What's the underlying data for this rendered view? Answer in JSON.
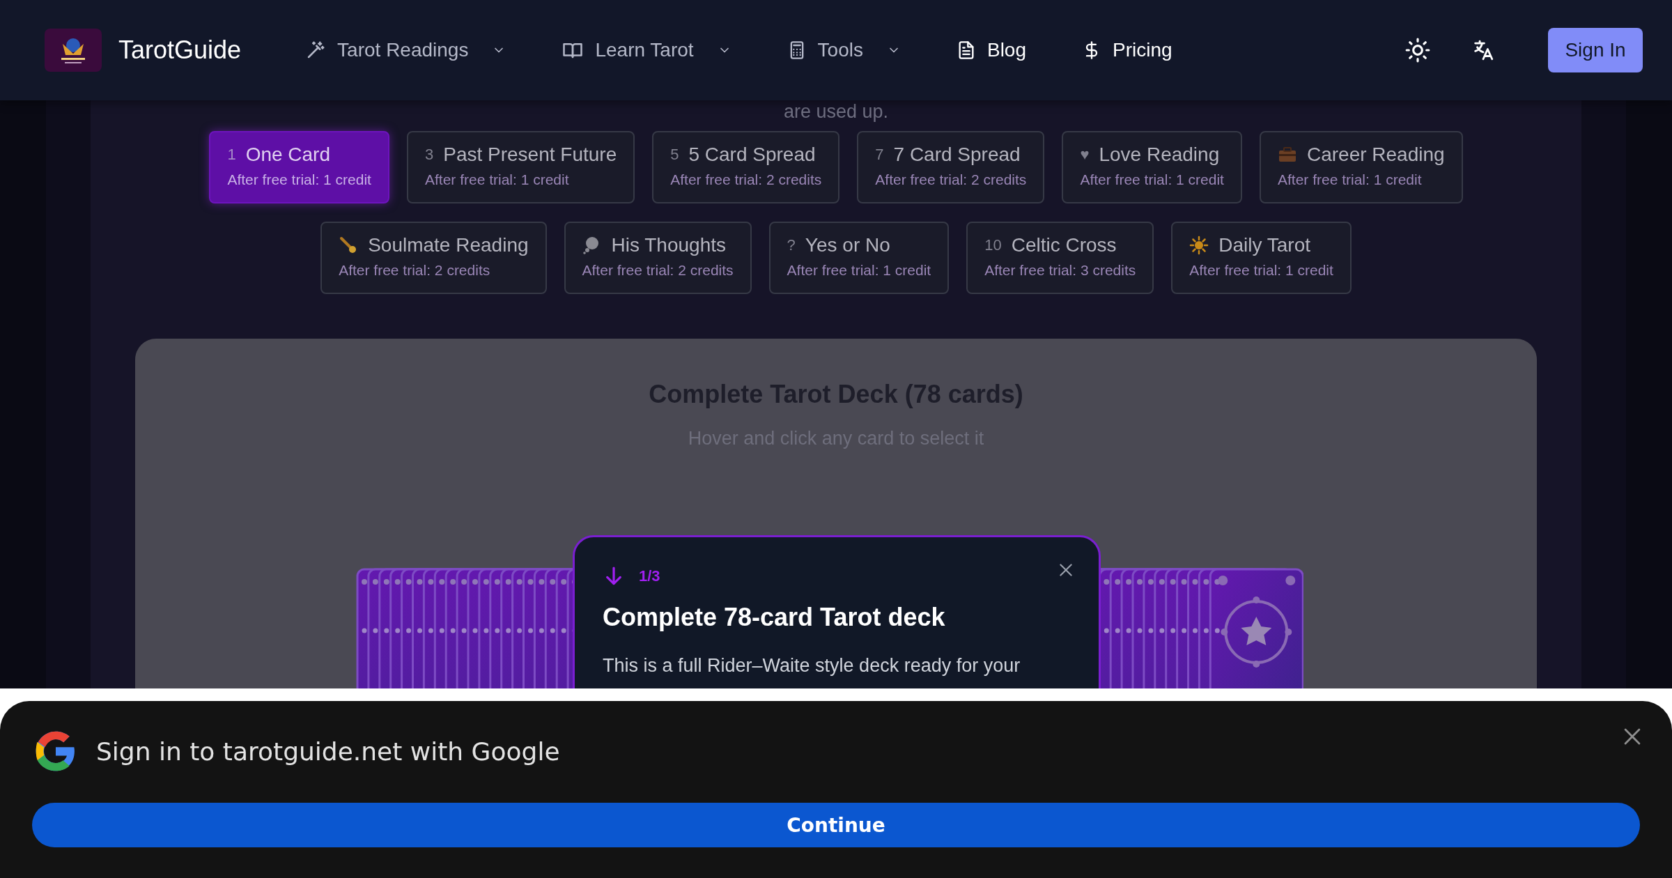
{
  "header": {
    "brand": "TarotGuide",
    "nav": [
      {
        "label": "Tarot Readings",
        "has_menu": true
      },
      {
        "label": "Learn Tarot",
        "has_menu": true
      },
      {
        "label": "Tools",
        "has_menu": true
      },
      {
        "label": "Blog",
        "has_menu": false
      },
      {
        "label": "Pricing",
        "has_menu": false
      }
    ],
    "sign_in": "Sign In"
  },
  "intro_tail": "are used up.",
  "spreads": [
    {
      "badge": "1",
      "title": "One Card",
      "cost": "After free trial: 1 credit",
      "selected": true
    },
    {
      "badge": "3",
      "title": "Past Present Future",
      "cost": "After free trial: 1 credit",
      "selected": false
    },
    {
      "badge": "5",
      "title": "5 Card Spread",
      "cost": "After free trial: 2 credits",
      "selected": false
    },
    {
      "badge": "7",
      "title": "7 Card Spread",
      "cost": "After free trial: 2 credits",
      "selected": false
    },
    {
      "badge": "♥",
      "title": "Love Reading",
      "cost": "After free trial: 1 credit",
      "selected": false
    },
    {
      "title": "Career Reading",
      "cost": "After free trial: 1 credit",
      "selected": false
    },
    {
      "title": "Soulmate Reading",
      "cost": "After free trial: 2 credits",
      "selected": false
    },
    {
      "title": "His Thoughts",
      "cost": "After free trial: 2 credits",
      "selected": false
    },
    {
      "badge": "?",
      "title": "Yes or No",
      "cost": "After free trial: 1 credit",
      "selected": false
    },
    {
      "badge": "10",
      "title": "Celtic Cross",
      "cost": "After free trial: 3 credits",
      "selected": false
    },
    {
      "title": "Daily Tarot",
      "cost": "After free trial: 1 credit",
      "selected": false
    }
  ],
  "deck": {
    "title": "Complete Tarot Deck (78 cards)",
    "hint": "Hover and click any card to select it"
  },
  "tour": {
    "step": "1/3",
    "title": "Complete 78-card Tarot deck",
    "text": "This is a full Rider–Waite style deck ready for your"
  },
  "google_prompt": {
    "text": "Sign in to tarotguide.net with Google",
    "button": "Continue"
  }
}
